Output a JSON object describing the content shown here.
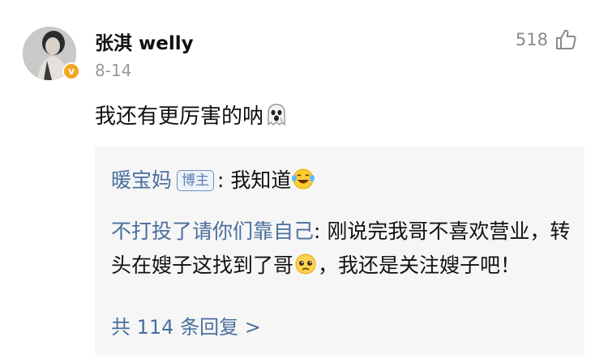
{
  "comment": {
    "username": "张淇 welly",
    "date": "8-14",
    "like_count": "518",
    "text": "我还有更厉害的呐",
    "icons": {
      "avatar": "avatar",
      "verified": "verified-badge-icon",
      "like": "thumbs-up-icon",
      "emoji": "ghost-emoji-icon"
    },
    "verified_mark": "v"
  },
  "replies": [
    {
      "author": "暖宝妈",
      "badge": "博主",
      "separator": ": ",
      "text": "我知道",
      "emoji": "laughing-tears-emoji-icon"
    },
    {
      "author": "不打投了请你们靠自己",
      "separator": ": ",
      "text_part1": "刚说完我哥不喜欢营业，转头在嫂子这找到了哥",
      "emoji": "pleading-face-emoji-icon",
      "text_part2": "，我还是关注嫂子吧！"
    }
  ],
  "more_replies": "共 114 条回复 >",
  "colors": {
    "link_blue": "#4a6f9e",
    "reply_bg": "#f6f6f6",
    "muted_gray": "#999999",
    "verified_orange": "#f5a623"
  }
}
